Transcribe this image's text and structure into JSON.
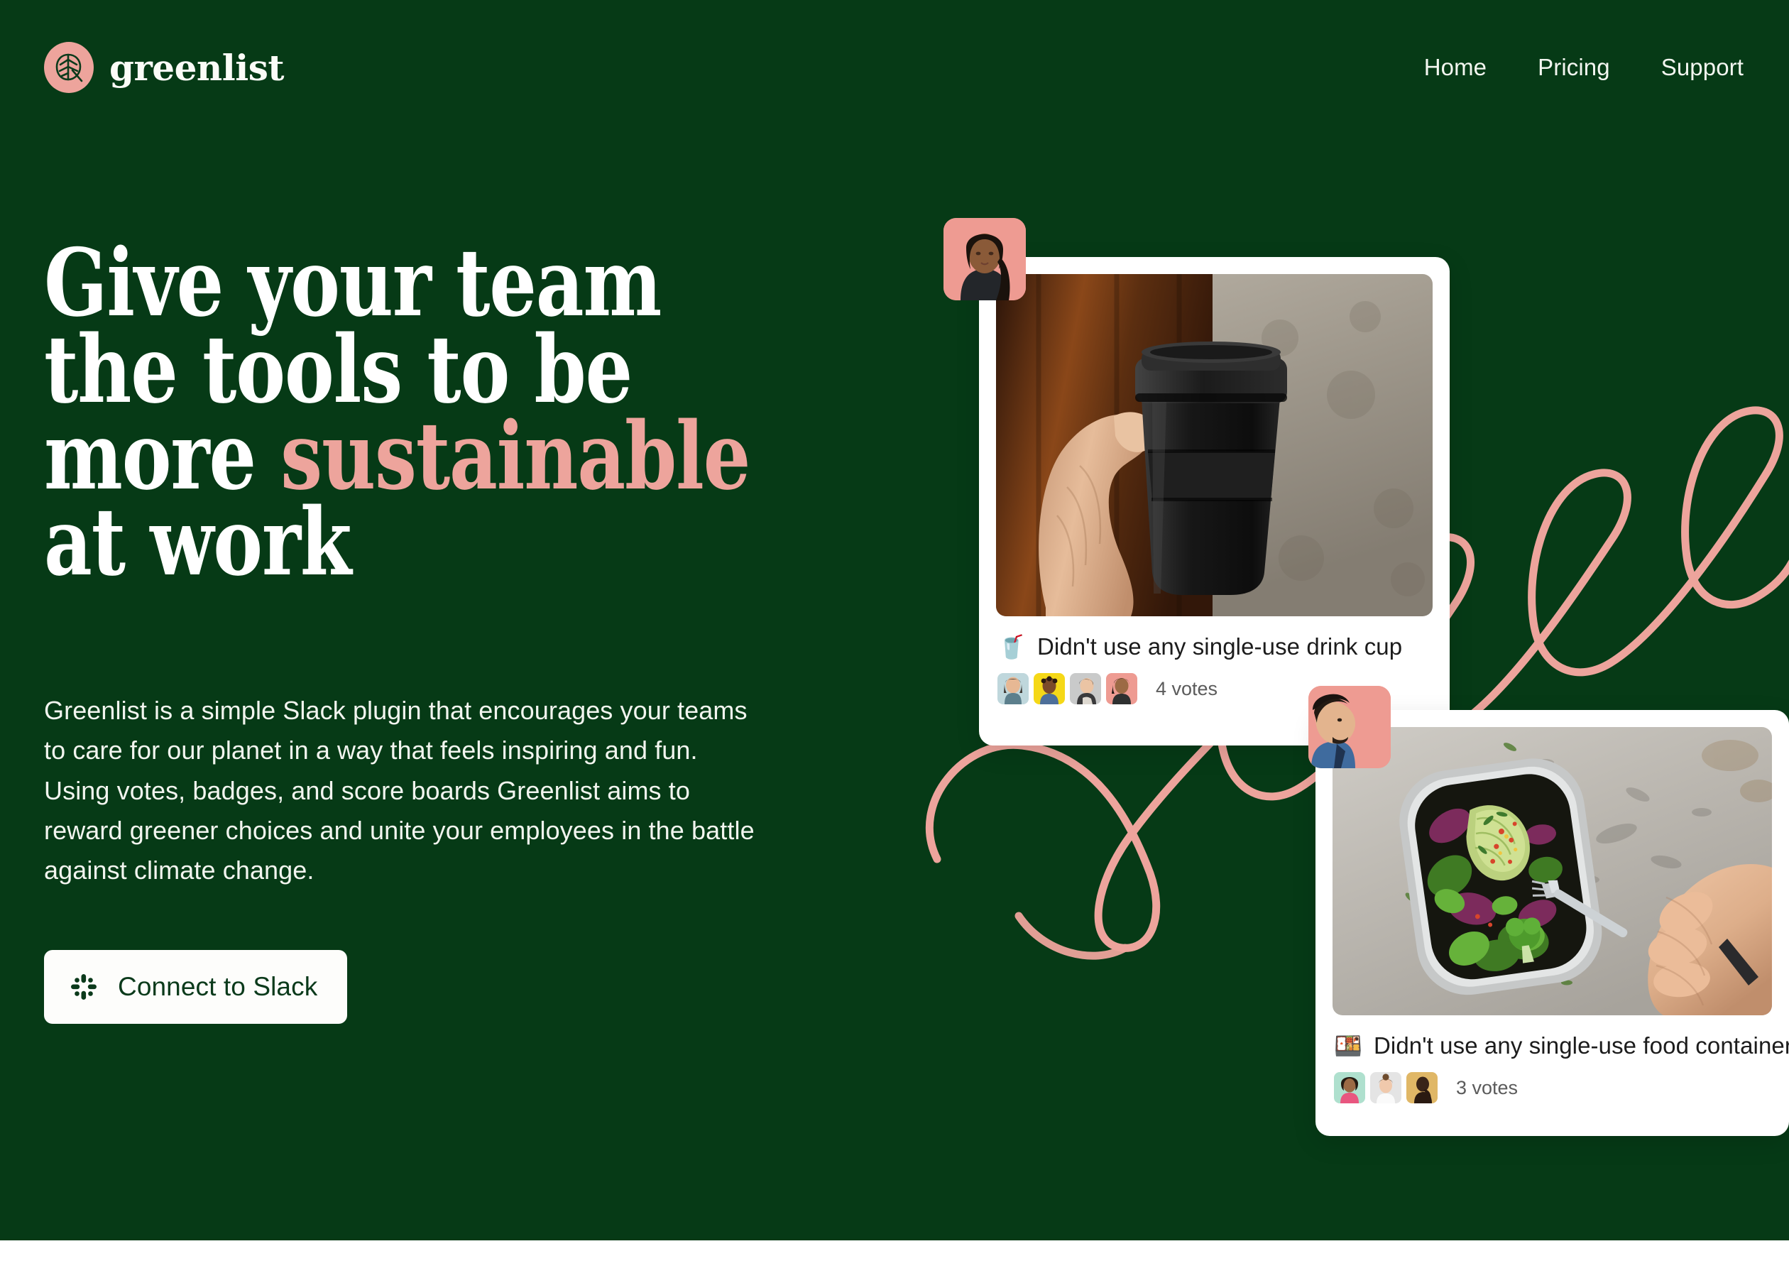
{
  "brand": {
    "name": "greenlist",
    "logo_icon": "leaf-icon"
  },
  "nav": {
    "items": [
      {
        "label": "Home"
      },
      {
        "label": "Pricing"
      },
      {
        "label": "Support"
      }
    ]
  },
  "hero": {
    "headline_line1": "Give your team",
    "headline_line2": "the tools to be",
    "headline_line3_plain": "more ",
    "headline_line3_accent": "sustainable",
    "headline_line4": "at work",
    "lede": "Greenlist is a simple Slack plugin that encourages your teams to care for our planet in a way that feels inspiring and fun. Using votes, badges, and score boards Greenlist aims to reward greener choices and unite your employees in the battle against climate change.",
    "cta_label": "Connect to Slack",
    "cta_icon": "slack-icon"
  },
  "cards": [
    {
      "emoji": "🥤",
      "title": "Didn't use any single-use drink cup",
      "votes_label": "4 votes",
      "photo_alt": "hand-holding-reusable-coffee-cup",
      "badge_alt": "woman-avatar-portrait",
      "voter_avatars": [
        {
          "name": "voter-avatar-1",
          "bg": "#BFD7DC"
        },
        {
          "name": "voter-avatar-2",
          "bg": "#F5D817"
        },
        {
          "name": "voter-avatar-3",
          "bg": "#C9CACA"
        },
        {
          "name": "voter-avatar-4",
          "bg": "#EE9B92"
        }
      ]
    },
    {
      "emoji": "🍱",
      "title": "Didn't use any single-use food container",
      "votes_label": "3 votes",
      "photo_alt": "salad-in-metal-lunch-box-with-fork",
      "badge_alt": "man-avatar-profile",
      "voter_avatars": [
        {
          "name": "voter-avatar-1",
          "bg": "#AFE0CE"
        },
        {
          "name": "voter-avatar-2",
          "bg": "#E4E4E4"
        },
        {
          "name": "voter-avatar-3",
          "bg": "#E0B766"
        }
      ]
    }
  ],
  "colors": {
    "background_green": "#063A16",
    "accent_pink": "#EDA49C",
    "text_white": "#FFFFFF",
    "card_white": "#FFFFFF"
  }
}
